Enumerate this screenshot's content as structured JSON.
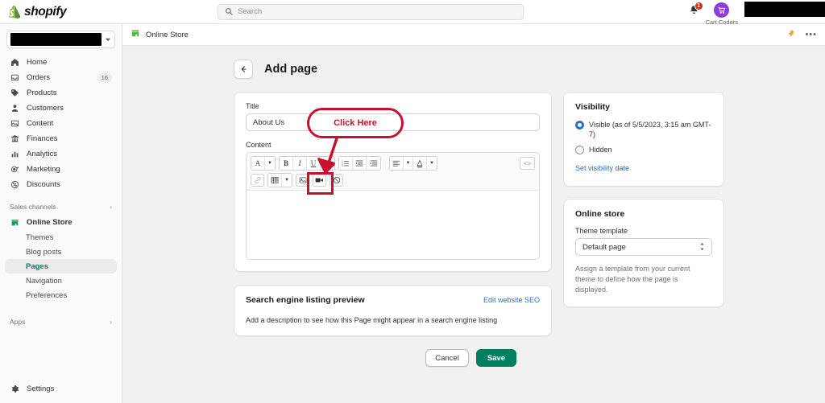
{
  "topbar": {
    "brand": "shopify",
    "brand_icon": "shopify-bag-icon",
    "search_placeholder": "Search",
    "search_icon": "search-icon",
    "notification_icon": "bell-icon",
    "notification_count": "1",
    "avatar_icon": "cart-icon",
    "account_name": "Cart Coders"
  },
  "sidebar": {
    "store_picker_icon": "chevron-down-icon",
    "items": [
      {
        "label": "Home",
        "icon": "home-icon",
        "count": ""
      },
      {
        "label": "Orders",
        "icon": "orders-inbox-icon",
        "count": "16"
      },
      {
        "label": "Products",
        "icon": "tag-icon",
        "count": ""
      },
      {
        "label": "Customers",
        "icon": "person-icon",
        "count": ""
      },
      {
        "label": "Content",
        "icon": "content-image-icon",
        "count": ""
      },
      {
        "label": "Finances",
        "icon": "bank-icon",
        "count": ""
      },
      {
        "label": "Analytics",
        "icon": "bar-chart-icon",
        "count": ""
      },
      {
        "label": "Marketing",
        "icon": "megaphone-target-icon",
        "count": ""
      },
      {
        "label": "Discounts",
        "icon": "discount-percent-icon",
        "count": ""
      }
    ],
    "sales_channels_label": "Sales channels",
    "sales_channels_chevron": "chevron-right-icon",
    "online_store_label": "Online Store",
    "online_store_icon": "storefront-icon",
    "sub_items": [
      {
        "label": "Themes",
        "active": false
      },
      {
        "label": "Blog posts",
        "active": false
      },
      {
        "label": "Pages",
        "active": true
      },
      {
        "label": "Navigation",
        "active": false
      },
      {
        "label": "Preferences",
        "active": false
      }
    ],
    "apps_label": "Apps",
    "apps_chevron": "chevron-right-icon",
    "settings_label": "Settings",
    "settings_icon": "gear-icon"
  },
  "context_bar": {
    "channel_label": "Online Store",
    "channel_icon": "storefront-icon",
    "pin_icon": "pin-icon",
    "more_icon": "ellipsis-icon",
    "more_label": "•••"
  },
  "page": {
    "back_icon": "arrow-left-icon",
    "title": "Add page"
  },
  "form": {
    "title_label": "Title",
    "title_value": "About Us",
    "content_label": "Content",
    "toolbar_row1": [
      {
        "name": "font-style-icon",
        "glyph": "A",
        "type": "btn"
      },
      {
        "name": "font-style-dropdown-icon",
        "glyph": "▾",
        "type": "carat"
      },
      {
        "name": "bold-icon",
        "glyph": "B",
        "type": "btn"
      },
      {
        "name": "italic-icon",
        "glyph": "I",
        "type": "btn"
      },
      {
        "name": "underline-icon",
        "glyph": "U",
        "type": "btn"
      },
      {
        "name": "bulleted-list-icon",
        "glyph": "≡",
        "type": "btn"
      },
      {
        "name": "numbered-list-icon",
        "glyph": "≔",
        "type": "btn"
      },
      {
        "name": "outdent-icon",
        "glyph": "⇥",
        "type": "btn"
      },
      {
        "name": "indent-icon",
        "glyph": "⇤",
        "type": "btn"
      },
      {
        "name": "align-icon",
        "glyph": "≡",
        "type": "btn"
      },
      {
        "name": "align-dropdown-icon",
        "glyph": "▾",
        "type": "carat"
      },
      {
        "name": "text-color-icon",
        "glyph": "A",
        "type": "btn"
      },
      {
        "name": "text-color-dropdown-icon",
        "glyph": "▾",
        "type": "carat"
      }
    ],
    "code_view_icon": "code-brackets-icon",
    "code_view_glyph": "<>",
    "toolbar_row2": [
      {
        "name": "link-icon",
        "glyph": "🔗",
        "type": "disabled"
      },
      {
        "name": "table-icon",
        "glyph": "▦",
        "type": "btn"
      },
      {
        "name": "table-dropdown-icon",
        "glyph": "▾",
        "type": "carat"
      },
      {
        "name": "insert-image-icon",
        "glyph": "🖼",
        "type": "btn"
      },
      {
        "name": "insert-video-icon",
        "glyph": "📹",
        "type": "btn"
      },
      {
        "name": "clear-formatting-icon",
        "glyph": "⊘",
        "type": "btn"
      }
    ],
    "content_value": ""
  },
  "seo": {
    "title": "Search engine listing preview",
    "edit_link": "Edit website SEO",
    "description": "Add a description to see how this Page might appear in a search engine listing"
  },
  "visibility": {
    "title": "Visibility",
    "option_visible": "Visible (as of 5/5/2023, 3:15 am GMT-7)",
    "option_hidden": "Hidden",
    "selected": "visible",
    "set_date_link": "Set visibility date"
  },
  "online_store": {
    "title": "Online store",
    "template_label": "Theme template",
    "template_value": "Default page",
    "template_dropdown_icon": "up-down-arrows-icon",
    "help_text": "Assign a template from your current theme to define how the page is displayed."
  },
  "actions": {
    "cancel_label": "Cancel",
    "save_label": "Save"
  },
  "annotation": {
    "callout_text": "Click Here",
    "color": "#c8102e"
  },
  "colors": {
    "shopify_green": "#008060",
    "link_blue": "#2c6ecb",
    "accent_red": "#c8102e",
    "sidebar_bg": "#fafafa",
    "page_bg": "#f1f1f1"
  }
}
